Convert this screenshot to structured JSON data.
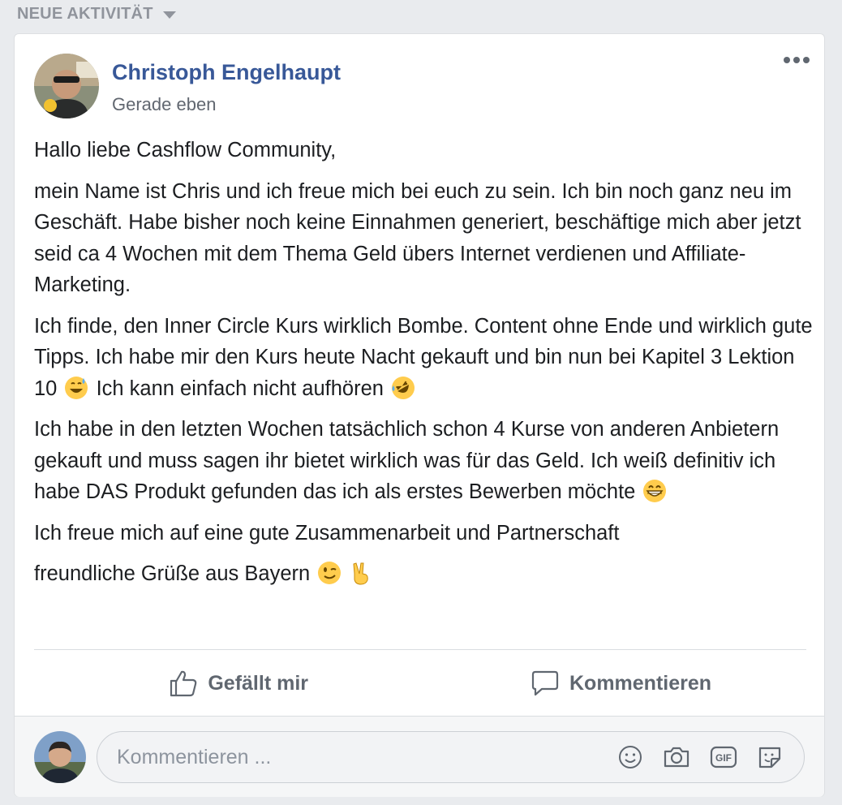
{
  "feed": {
    "section_label": "NEUE AKTIVITÄT"
  },
  "post": {
    "author": "Christoph Engelhaupt",
    "timestamp": "Gerade eben",
    "paragraphs": {
      "p1": "Hallo liebe Cashflow Community,",
      "p2": "mein Name ist Chris und ich freue mich bei euch zu sein. Ich bin noch ganz neu im Geschäft. Habe bisher noch keine Einnahmen generiert, beschäftige mich aber jetzt seid ca 4 Wochen mit dem Thema Geld übers Internet verdienen und Affiliate-Marketing.",
      "p3a": "Ich finde, den Inner Circle Kurs wirklich Bombe. Content ohne Ende und wirklich gute Tipps. Ich habe mir den Kurs heute Nacht gekauft und bin nun bei Kapitel 3 Lektion 10",
      "p3b": "Ich kann einfach nicht aufhören",
      "p4": "Ich habe in den letzten Wochen tatsächlich schon 4 Kurse von anderen Anbietern gekauft und muss sagen ihr bietet wirklich was für das Geld. Ich weiß definitiv ich habe DAS Produkt gefunden das ich als erstes Bewerben möchte",
      "p5": "Ich freue mich auf eine gute Zusammenarbeit und Partnerschaft",
      "p6": "freundliche Grüße aus Bayern"
    },
    "emojis": [
      "grinning-sweat-emoji",
      "rolling-on-floor-laughing-emoji",
      "beaming-grin-emoji",
      "winking-face-emoji",
      "victory-hand-emoji"
    ]
  },
  "actions": {
    "like_label": "Gefällt mir",
    "comment_label": "Kommentieren"
  },
  "comment_box": {
    "placeholder": "Kommentieren ..."
  },
  "colors": {
    "author_link": "#385898",
    "muted": "#606770",
    "background": "#e9ebee",
    "emoji_yellow": "#ffcc4d"
  }
}
